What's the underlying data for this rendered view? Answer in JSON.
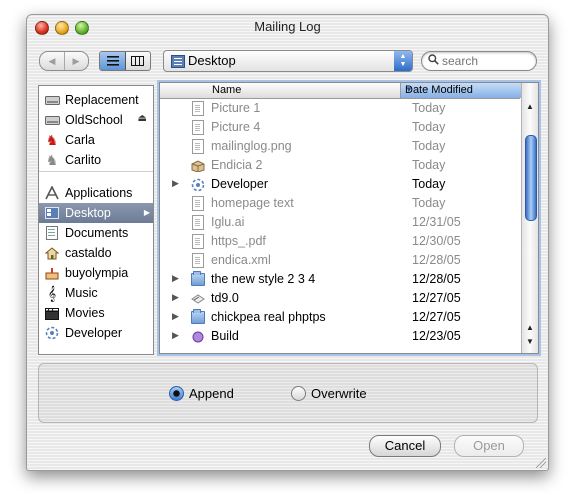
{
  "window": {
    "title": "Mailing Log"
  },
  "toolbar": {
    "back_glyph": "◀",
    "forward_glyph": "▶",
    "location": "Desktop",
    "search_placeholder": "search"
  },
  "sidebar": {
    "devices": [
      {
        "label": "Replacement",
        "icon": "hard-drive-icon"
      },
      {
        "label": "OldSchool",
        "icon": "hard-drive-icon",
        "eject": "⏏"
      },
      {
        "label": "Carla",
        "icon": "red-chess-piece-icon"
      },
      {
        "label": "Carlito",
        "icon": "white-chess-piece-icon"
      }
    ],
    "places": [
      {
        "label": "Applications",
        "icon": "applications-icon"
      },
      {
        "label": "Desktop",
        "icon": "desktop-icon",
        "selected": true
      },
      {
        "label": "Documents",
        "icon": "documents-icon"
      },
      {
        "label": "castaldo",
        "icon": "home-icon"
      },
      {
        "label": "buyolympia",
        "icon": "cake-icon"
      },
      {
        "label": "Music",
        "icon": "music-note-icon"
      },
      {
        "label": "Movies",
        "icon": "film-clapper-icon"
      },
      {
        "label": "Developer",
        "icon": "developer-icon"
      }
    ]
  },
  "browser": {
    "columns": {
      "name": "Name",
      "date_modified": "Date Modified"
    },
    "sorted_column": "date_modified",
    "rows": [
      {
        "name": "Picture 1",
        "date": "Today",
        "icon": "document-icon",
        "enabled": false,
        "folder": false
      },
      {
        "name": "Picture 4",
        "date": "Today",
        "icon": "document-icon",
        "enabled": false,
        "folder": false
      },
      {
        "name": "mailinglog.png",
        "date": "Today",
        "icon": "document-icon",
        "enabled": false,
        "folder": false
      },
      {
        "name": "Endicia 2",
        "date": "Today",
        "icon": "package-icon",
        "enabled": false,
        "folder": false
      },
      {
        "name": "Developer",
        "date": "Today",
        "icon": "developer-icon",
        "enabled": true,
        "folder": true
      },
      {
        "name": "homepage text",
        "date": "Today",
        "icon": "document-icon",
        "enabled": false,
        "folder": false
      },
      {
        "name": "Iglu.ai",
        "date": "12/31/05",
        "icon": "document-icon",
        "enabled": false,
        "folder": false
      },
      {
        "name": "https_.pdf",
        "date": "12/30/05",
        "icon": "document-icon",
        "enabled": false,
        "folder": false
      },
      {
        "name": "endica.xml",
        "date": "12/28/05",
        "icon": "document-icon",
        "enabled": false,
        "folder": false
      },
      {
        "name": "the new style 2 3 4",
        "date": "12/28/05",
        "icon": "folder-icon",
        "enabled": true,
        "folder": true
      },
      {
        "name": "td9.0",
        "date": "12/27/05",
        "icon": "alias-icon",
        "enabled": true,
        "folder": true
      },
      {
        "name": "chickpea real phptps",
        "date": "12/27/05",
        "icon": "folder-icon",
        "enabled": true,
        "folder": true
      },
      {
        "name": "Build",
        "date": "12/23/05",
        "icon": "build-icon",
        "enabled": true,
        "folder": true
      }
    ]
  },
  "options": {
    "append_label": "Append",
    "overwrite_label": "Overwrite",
    "selected": "append"
  },
  "buttons": {
    "cancel": "Cancel",
    "open": "Open"
  },
  "colors": {
    "selection": "#6c7b95",
    "focus_ring": "#a8c3ea",
    "scroll_thumb": "#3d6fc4"
  }
}
